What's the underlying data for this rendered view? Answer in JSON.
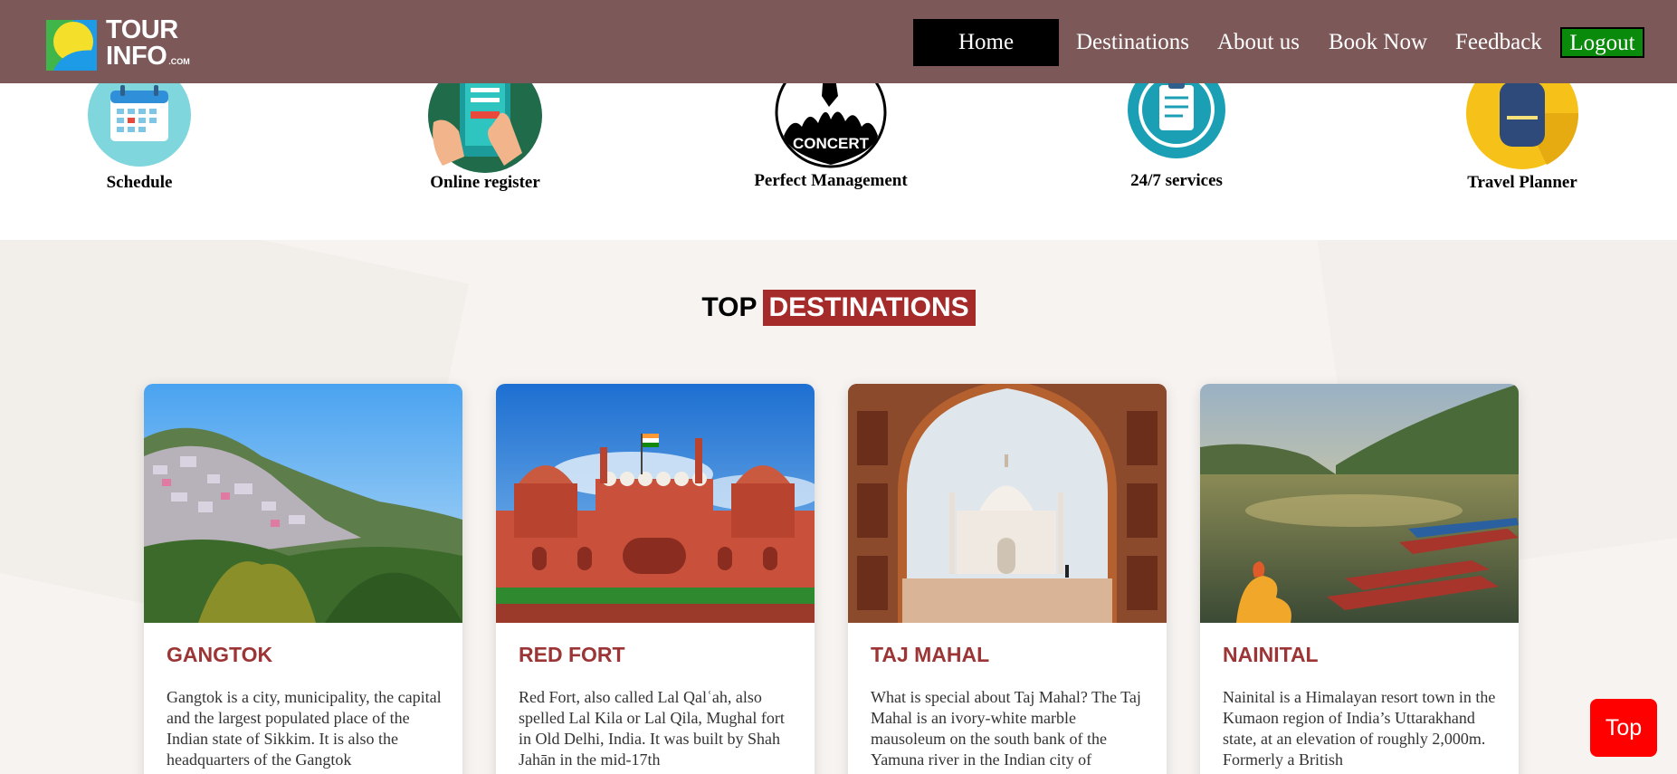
{
  "brand": {
    "line1": "TOUR",
    "line2": "INFO",
    "suffix": ".COM"
  },
  "nav": {
    "home": "Home",
    "destinations": "Destinations",
    "about": "About us",
    "book": "Book Now",
    "feedback": "Feedback",
    "logout": "Logout"
  },
  "features": [
    {
      "label": "Schedule",
      "icon": "calendar-icon"
    },
    {
      "label": "Online register",
      "icon": "register-phone-icon"
    },
    {
      "label": "Perfect Management",
      "icon": "concert-icon"
    },
    {
      "label": "24/7 services",
      "icon": "clipboard-cycle-icon"
    },
    {
      "label": "Travel Planner",
      "icon": "backpack-icon"
    }
  ],
  "section": {
    "heading_plain": "TOP",
    "heading_highlight": "DESTINATIONS"
  },
  "destinations": [
    {
      "title": "GANGTOK",
      "description": "Gangtok is a city, municipality, the capital and the largest populated place of the Indian state of Sikkim. It is also the headquarters of the Gangtok"
    },
    {
      "title": "RED FORT",
      "description": "Red Fort, also called Lal Qalʿah, also spelled Lal Kila or Lal Qila, Mughal fort in Old Delhi, India. It was built by Shah Jahān in the mid-17th"
    },
    {
      "title": "TAJ MAHAL",
      "description": "What is special about Taj Mahal? The Taj Mahal is an ivory-white marble mausoleum on the south bank of the Yamuna river in the Indian city of"
    },
    {
      "title": "NAINITAL",
      "description": "Nainital is a Himalayan resort town in the Kumaon region of India’s Uttarakhand state, at an elevation of roughly 2,000m. Formerly a British"
    }
  ],
  "top_button": "Top",
  "colors": {
    "header": "#7d5858",
    "heading_highlight": "#a52a2a",
    "card_title": "#9c3535",
    "logout": "#0a8a0a",
    "top_button": "#ff0000"
  }
}
